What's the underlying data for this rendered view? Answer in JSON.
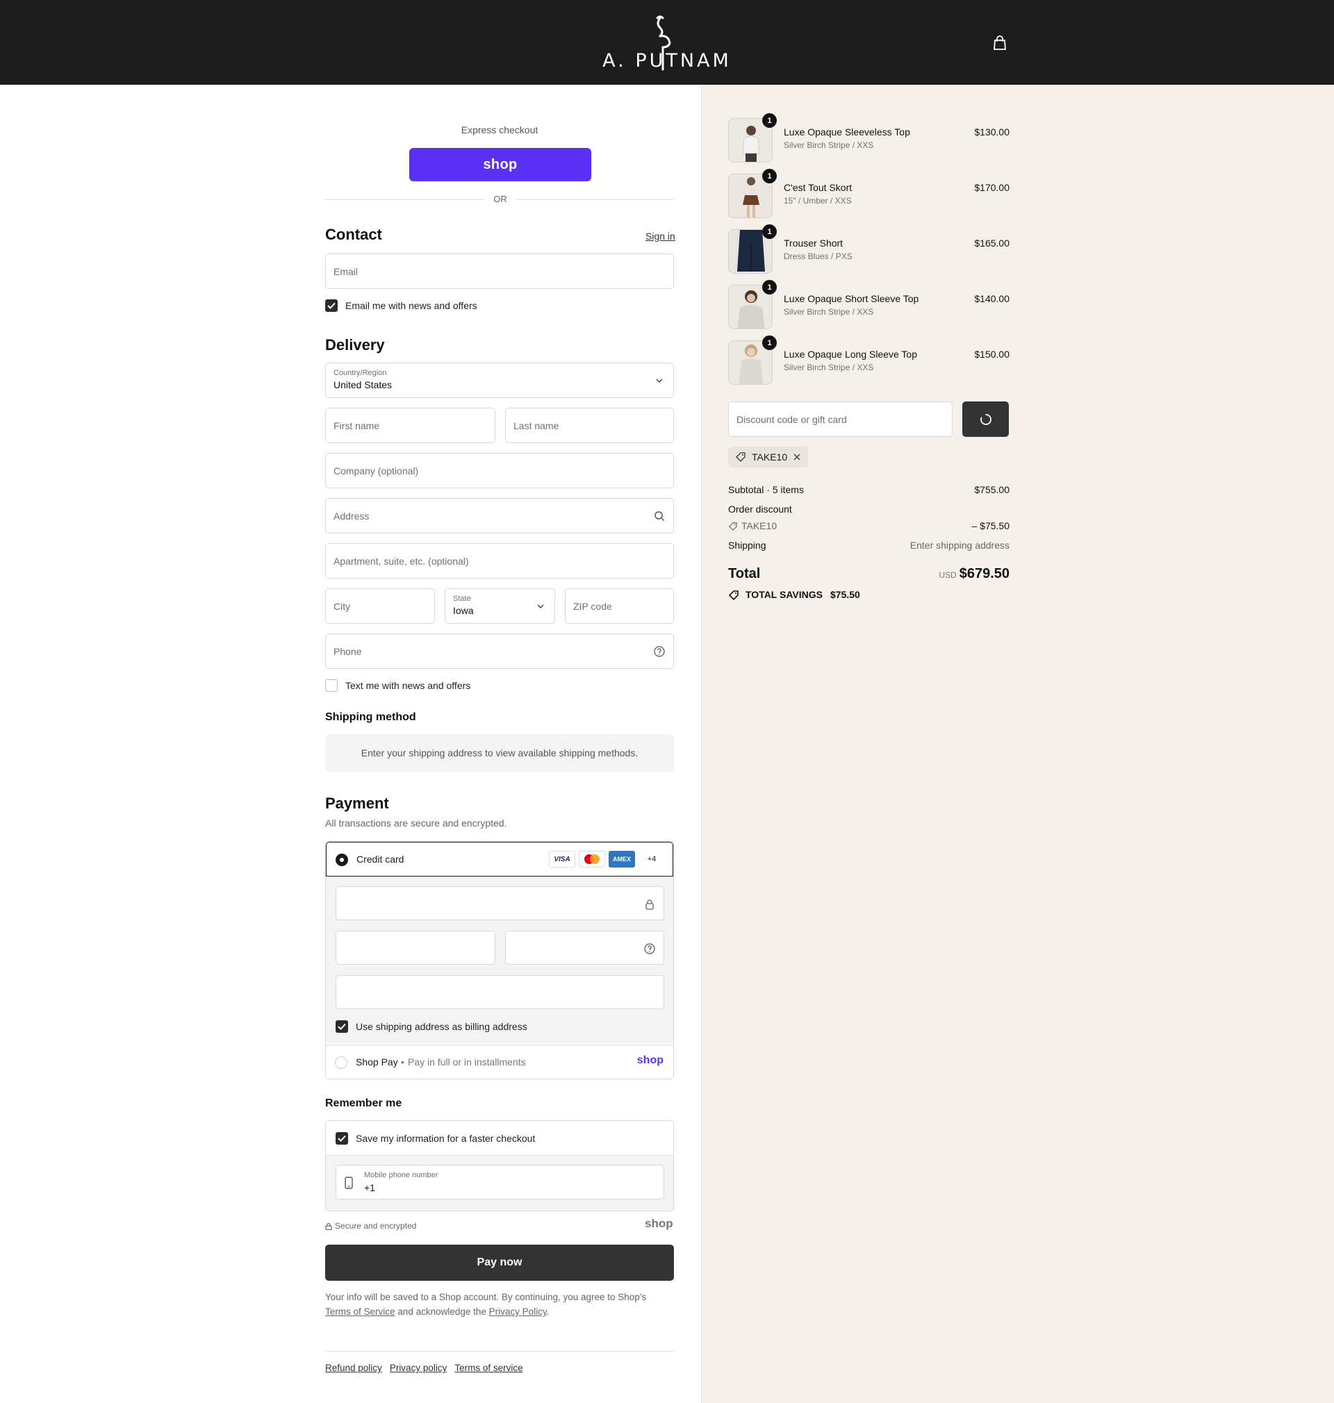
{
  "brand": {
    "name": "A. PUTNAM"
  },
  "express": {
    "label": "Express checkout",
    "shop_label": "shop",
    "or": "OR"
  },
  "contact": {
    "title": "Contact",
    "sign_in": "Sign in",
    "email_placeholder": "Email",
    "news_label": "Email me with news and offers",
    "news_checked": true
  },
  "delivery": {
    "title": "Delivery",
    "country_label": "Country/Region",
    "country_value": "United States",
    "first_name": "First name",
    "last_name": "Last name",
    "company": "Company (optional)",
    "address": "Address",
    "apartment": "Apartment, suite, etc. (optional)",
    "city": "City",
    "state_label": "State",
    "state_value": "Iowa",
    "zip": "ZIP code",
    "phone": "Phone",
    "text_label": "Text me with news and offers",
    "text_checked": false
  },
  "shipping": {
    "title": "Shipping method",
    "message": "Enter your shipping address to view available shipping methods."
  },
  "payment": {
    "title": "Payment",
    "subtitle": "All transactions are secure and encrypted.",
    "credit_card": "Credit card",
    "cards": {
      "visa": "VISA",
      "amex": "AMEX",
      "more": "+4"
    },
    "billing_label": "Use shipping address as billing address",
    "shop_pay": "Shop Pay",
    "shop_pay_desc": "Pay in full or in installments",
    "shop_logo": "shop"
  },
  "remember": {
    "title": "Remember me",
    "save_label": "Save my information for a faster checkout",
    "mobile_label": "Mobile phone number",
    "mobile_value": "+1",
    "secure": "Secure and encrypted",
    "shop_logo": "shop"
  },
  "pay_now": "Pay now",
  "legal": {
    "part1": "Your info will be saved to a Shop account. By continuing, you agree to Shop’s",
    "terms": "Terms of Service",
    "part2": "and acknowledge the",
    "privacy": "Privacy Policy",
    "end": "."
  },
  "footer": {
    "refund": "Refund policy",
    "privacy": "Privacy policy",
    "terms": "Terms of service"
  },
  "order": {
    "items": [
      {
        "name": "Luxe Opaque Sleeveless Top",
        "variant": "Silver Birch Stripe / XXS",
        "price": "$130.00",
        "qty": "1"
      },
      {
        "name": "C'est Tout Skort",
        "variant": "15\" / Umber / XXS",
        "price": "$170.00",
        "qty": "1"
      },
      {
        "name": "Trouser Short",
        "variant": "Dress Blues / PXS",
        "price": "$165.00",
        "qty": "1"
      },
      {
        "name": "Luxe Opaque Short Sleeve Top",
        "variant": "Silver Birch Stripe / XXS",
        "price": "$140.00",
        "qty": "1"
      },
      {
        "name": "Luxe Opaque Long Sleeve Top",
        "variant": "Silver Birch Stripe / XXS",
        "price": "$150.00",
        "qty": "1"
      }
    ],
    "discount_placeholder": "Discount code or gift card",
    "applied_code": "TAKE10",
    "subtotal_label": "Subtotal · 5 items",
    "subtotal": "$755.00",
    "order_discount_label": "Order discount",
    "discount_code": "TAKE10",
    "discount_value": "– $75.50",
    "shipping_label": "Shipping",
    "shipping_value": "Enter shipping address",
    "total_label": "Total",
    "currency": "USD",
    "total": "$679.50",
    "savings_label": "TOTAL SAVINGS",
    "savings": "$75.50"
  }
}
